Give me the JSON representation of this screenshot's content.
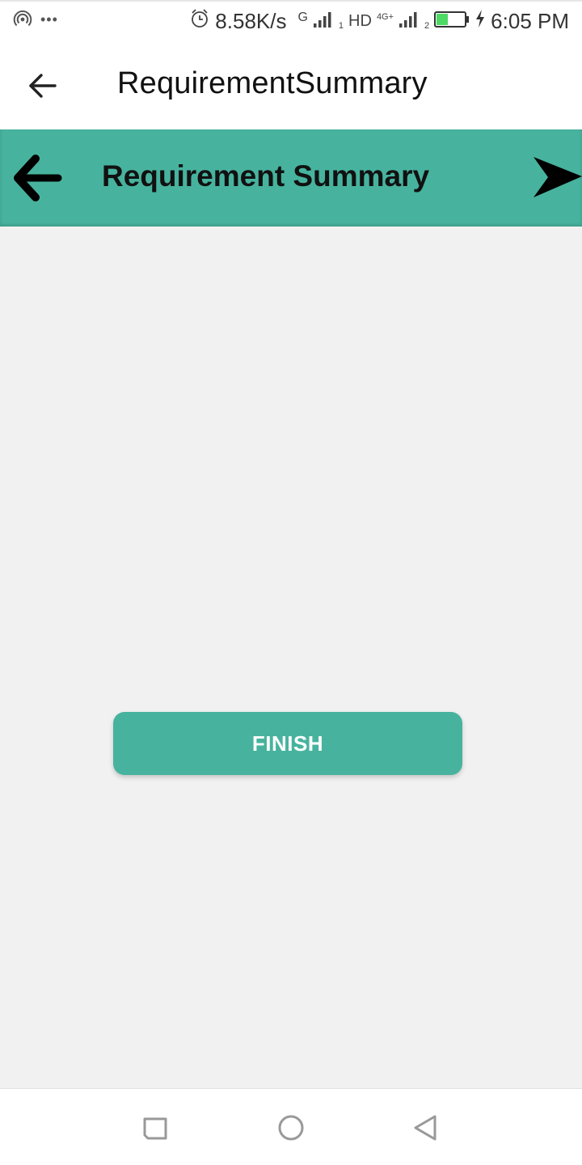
{
  "status_bar": {
    "net_speed": "8.58K/s",
    "sim1_network": "G",
    "sim1_slot": "1",
    "hd_label": "HD",
    "sim2_network": "4G+",
    "sim2_slot": "2",
    "time": "6:05 PM",
    "battery_color": "#4cd964",
    "icons": [
      "hotspot-icon",
      "more-dots-icon",
      "alarm-icon",
      "signal-icon",
      "battery-icon",
      "charging-icon"
    ]
  },
  "app_bar": {
    "title": "RequirementSummary"
  },
  "header": {
    "title": "Requirement Summary",
    "background": "#47b39e"
  },
  "actions": {
    "finish_label": "FINISH"
  },
  "nav_bar": {
    "icons": [
      "recents-icon",
      "home-icon",
      "back-icon"
    ]
  }
}
